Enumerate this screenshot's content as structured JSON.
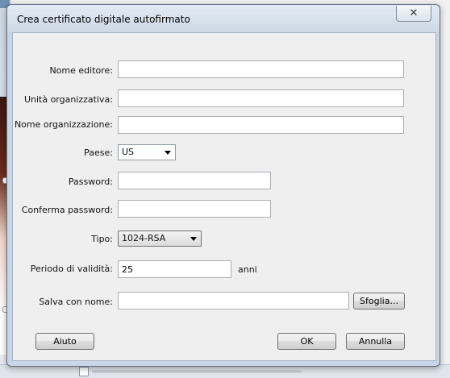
{
  "dialog": {
    "title": "Crea certificato digitale autofirmato",
    "close_glyph": "✕"
  },
  "form": {
    "publisher_label": "Nome editore:",
    "publisher_value": "",
    "org_unit_label": "Unità organizzativa:",
    "org_unit_value": "",
    "org_name_label": "Nome organizzazione:",
    "org_name_value": "",
    "country_label": "Paese:",
    "country_value": "US",
    "password_label": "Password:",
    "password_value": "",
    "confirm_label": "Conferma password:",
    "confirm_value": "",
    "type_label": "Tipo:",
    "type_value": "1024-RSA",
    "validity_label": "Periodo di validità:",
    "validity_value": "25",
    "validity_unit": "anni",
    "save_label": "Salva con nome:",
    "save_value": "",
    "browse_label": "Sfoglia..."
  },
  "buttons": {
    "help": "Aiuto",
    "ok": "OK",
    "cancel": "Annulla"
  },
  "icons": {
    "close": "close-icon",
    "dropdown": "chevron-down-icon"
  }
}
